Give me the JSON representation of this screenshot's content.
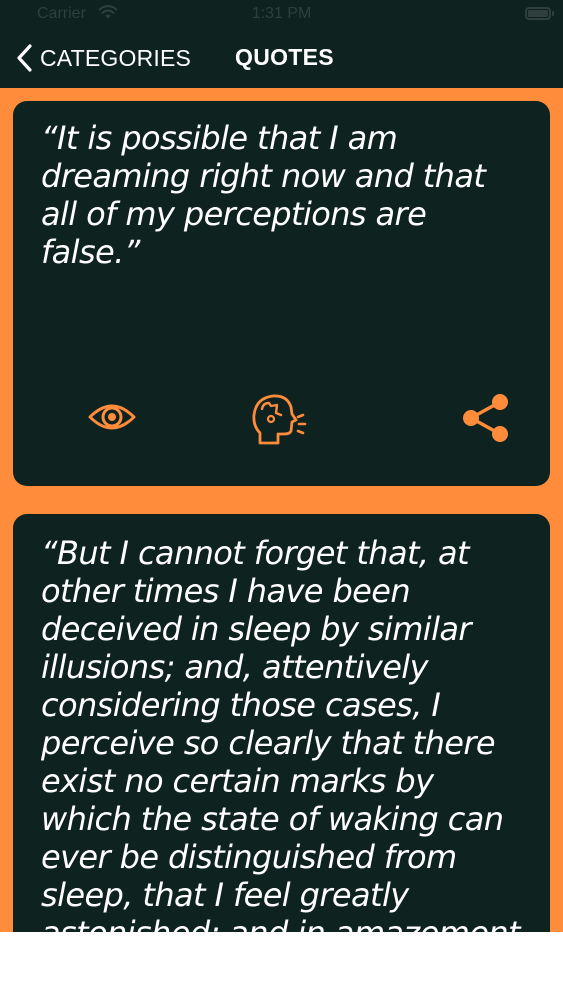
{
  "status_bar": {
    "carrier": "Carrier",
    "time": "1:31 PM"
  },
  "nav": {
    "back_label": "CATEGORIES",
    "title": "QUOTES"
  },
  "quotes": [
    {
      "text": "“It is possible that I am dreaming right now and that all of my perceptions are false.”"
    },
    {
      "text": "“But I cannot forget that, at other times I have been deceived in sleep by similar illusions; and, attentively considering those cases, I perceive so clearly that there exist no certain marks by which the state of waking can ever be distinguished from sleep, that I feel greatly astonished; and in amazement I almost persuade"
    }
  ],
  "actions": {
    "view_icon": "eye-icon",
    "speak_icon": "speaking-head-icon",
    "share_icon": "share-icon"
  },
  "colors": {
    "background": "#ff8c3a",
    "card": "#0e2220",
    "text": "#ffffff",
    "accent": "#ff8c3a"
  }
}
